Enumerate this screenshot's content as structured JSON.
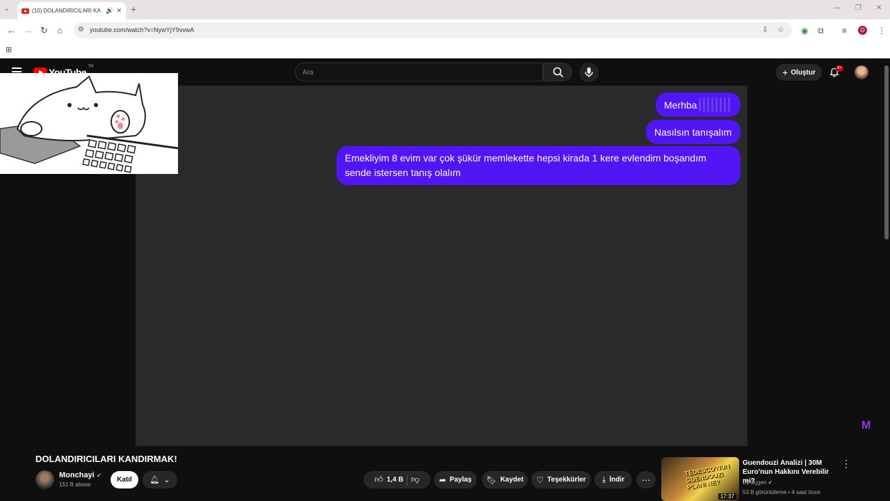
{
  "browser": {
    "tab_title": "(10) DOLANDIRICILARI KA",
    "url": "youtube.com/watch?v=NywYjY9vvwA"
  },
  "youtube": {
    "logo_text": "YouTube",
    "region": "TR",
    "search_placeholder": "Ara",
    "create_label": "Oluştur",
    "notif_count": "9+"
  },
  "chat": {
    "msg1": "Merhba",
    "msg2": "Nasılsın tanışalım",
    "msg3_line1": "Emekliyim 8 evim var çok şükür memlekette hepsi kirada 1 kere evlendim boşandım",
    "msg3_line2": "sende istersen tanış olalım"
  },
  "video": {
    "title": "DOLANDIRICILARI KANDIRMAK!",
    "channel": "Monchayi",
    "subscribers": "151 B abone",
    "join_label": "Katıl",
    "likes": "1,4 B",
    "share_label": "Paylaş",
    "save_label": "Kaydet",
    "thanks_label": "Teşekkürler",
    "download_label": "İndir"
  },
  "recommendation": {
    "title": "Guendouzi Analizi | 30M Euro'nun Hakkını Verebilir mi?",
    "channel": "L1 Üçgen",
    "meta": "53 B görüntüleme • 4 saat önce",
    "duration": "17:37",
    "thumb_text": "TEDESCO'NUN GUENDOUZI PLANI NE?"
  }
}
